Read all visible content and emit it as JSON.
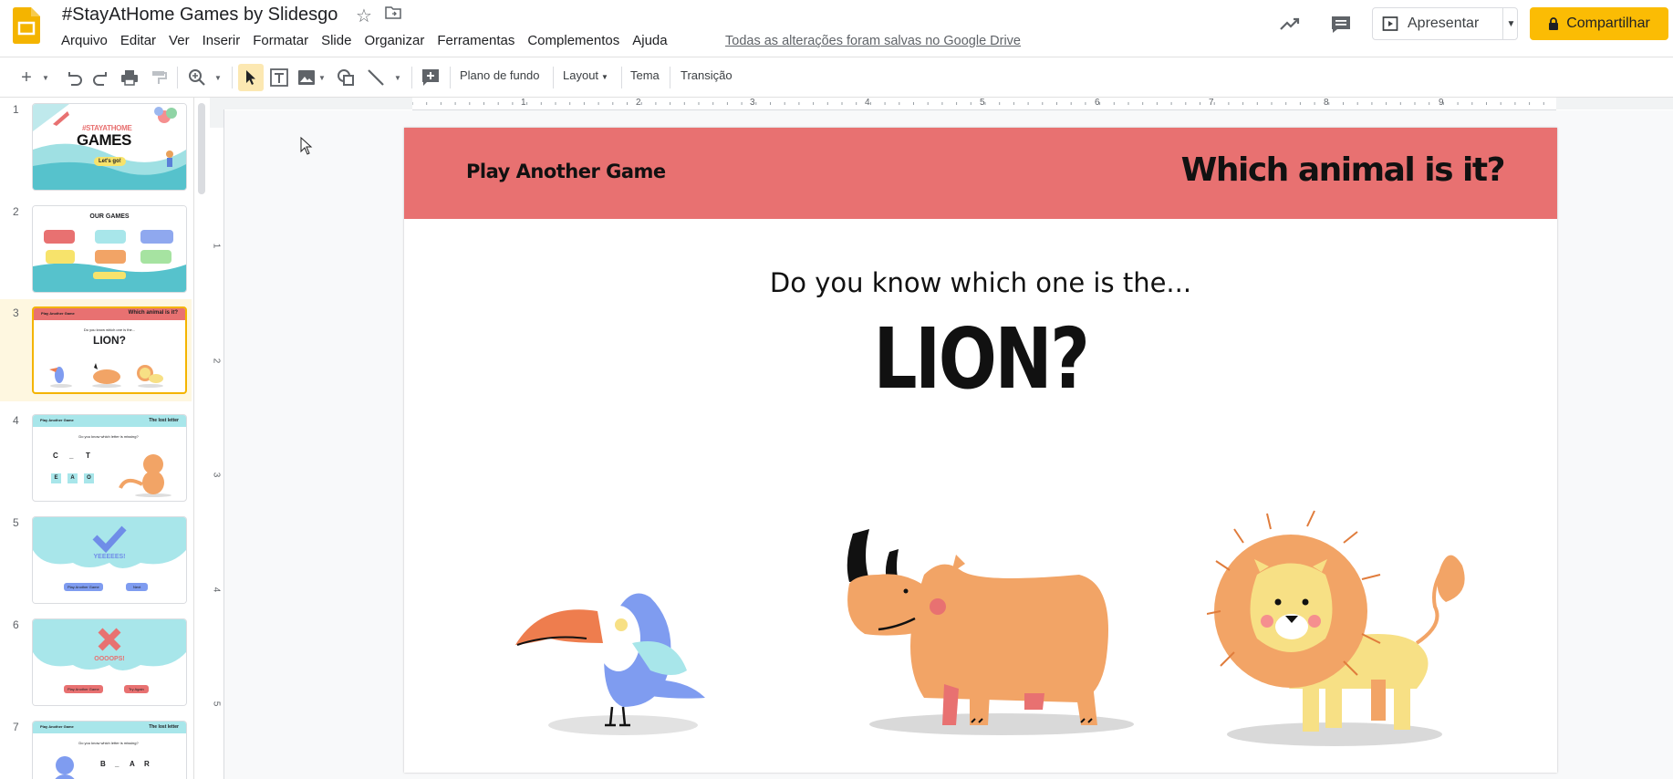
{
  "header": {
    "doc_title": "#StayAtHome Games by Slidesgo",
    "menu": [
      "Arquivo",
      "Editar",
      "Ver",
      "Inserir",
      "Formatar",
      "Slide",
      "Organizar",
      "Ferramentas",
      "Complementos",
      "Ajuda"
    ],
    "saved_status": "Todas as alterações foram salvas no Google Drive",
    "present_label": "Apresentar",
    "share_label": "Compartilhar",
    "accent": "#fbbc04"
  },
  "toolbar": {
    "background_label": "Plano de fundo",
    "layout_label": "Layout",
    "theme_label": "Tema",
    "transition_label": "Transição"
  },
  "ruler": {
    "h_numbers": [
      "1",
      "2",
      "3",
      "4",
      "5",
      "6",
      "7",
      "8",
      "9"
    ],
    "v_numbers": [
      "1",
      "2",
      "3",
      "4",
      "5"
    ]
  },
  "filmstrip": {
    "selected_index": 3,
    "slides": [
      {
        "num": "1",
        "title_small": "#STAYATHOME",
        "title": "GAMES",
        "button": "Let's go!"
      },
      {
        "num": "2",
        "title": "OUR GAMES",
        "cards": [
          "Which animal is it?",
          "The lost letter",
          "How many are there?",
          "Guess the color",
          "Whose shadow is it?",
          "Let's do a puzzle!"
        ],
        "footer": "Have you finished?"
      },
      {
        "num": "3",
        "left": "Play Another Game",
        "right": "Which animal is it?",
        "q": "Do you know which one is the...",
        "a": "LION?"
      },
      {
        "num": "4",
        "left": "Play Another Game",
        "right": "The lost letter",
        "q": "Do you know which letter is missing?",
        "letters": [
          "C",
          "_",
          "T"
        ],
        "options": [
          "E",
          "A",
          "O"
        ]
      },
      {
        "num": "5",
        "text": "YEEEEES!",
        "b1": "Play Another Game",
        "b2": "Next"
      },
      {
        "num": "6",
        "text": "OOOOPS!",
        "b1": "Play Another Game",
        "b2": "Try Again"
      },
      {
        "num": "7",
        "left": "Play Another Game",
        "right": "The lost letter",
        "q": "Do you know which letter is missing?",
        "letters": [
          "B",
          "_",
          "A",
          "R"
        ]
      }
    ]
  },
  "slide": {
    "header_color": "#e87171",
    "left_label": "Play Another Game",
    "right_title": "Which animal is it?",
    "question": "Do you know which one is the...",
    "answer": "LION?",
    "animals": [
      "toucan-illustration",
      "rhino-illustration",
      "lion-illustration"
    ]
  }
}
